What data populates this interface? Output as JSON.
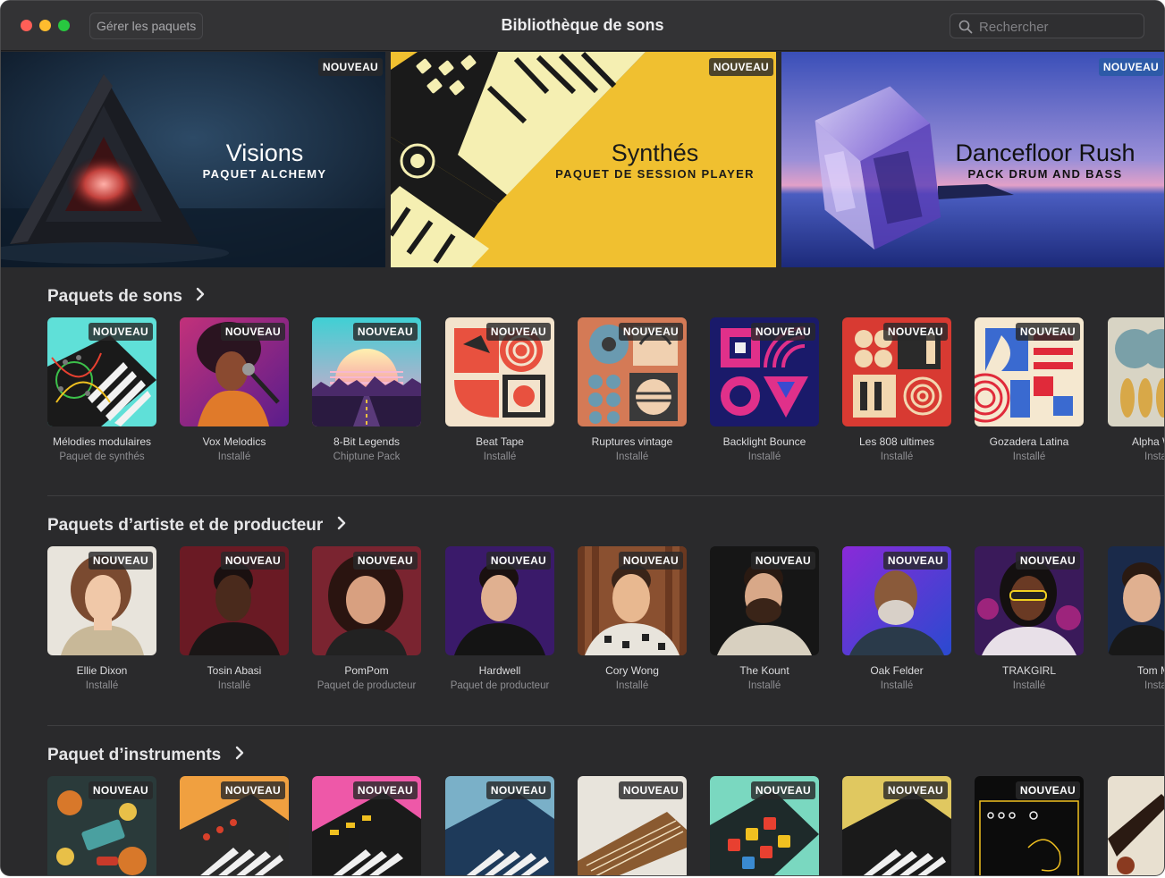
{
  "window": {
    "title": "Bibliothèque de sons",
    "manage_button": "Gérer les paquets",
    "search_placeholder": "Rechercher"
  },
  "badge_label": "NOUVEAU",
  "featured": [
    {
      "title": "Visions",
      "subtitle": "PAQUET ALCHEMY",
      "badge": "NOUVEAU"
    },
    {
      "title": "Synthés",
      "subtitle": "PAQUET DE SESSION PLAYER",
      "badge": "NOUVEAU"
    },
    {
      "title": "Dancefloor Rush",
      "subtitle": "PACK DRUM AND BASS",
      "badge": "NOUVEAU"
    }
  ],
  "sections": [
    {
      "title": "Paquets de sons",
      "items": [
        {
          "name": "Mélodies modulaires",
          "status": "Paquet de synthés",
          "badge": "NOUVEAU"
        },
        {
          "name": "Vox Melodics",
          "status": "Installé",
          "badge": "NOUVEAU"
        },
        {
          "name": "8-Bit Legends",
          "status": "Chiptune Pack",
          "badge": "NOUVEAU"
        },
        {
          "name": "Beat Tape",
          "status": "Installé",
          "badge": "NOUVEAU"
        },
        {
          "name": "Ruptures vintage",
          "status": "Installé",
          "badge": "NOUVEAU"
        },
        {
          "name": "Backlight Bounce",
          "status": "Installé",
          "badge": "NOUVEAU"
        },
        {
          "name": "Les 808 ultimes",
          "status": "Installé",
          "badge": "NOUVEAU"
        },
        {
          "name": "Gozadera Latina",
          "status": "Installé",
          "badge": "NOUVEAU"
        },
        {
          "name": "Alpha W",
          "status": "Insta",
          "badge": ""
        }
      ]
    },
    {
      "title": "Paquets d’artiste et de producteur",
      "items": [
        {
          "name": "Ellie Dixon",
          "status": "Installé",
          "badge": "NOUVEAU"
        },
        {
          "name": "Tosin Abasi",
          "status": "Installé",
          "badge": "NOUVEAU"
        },
        {
          "name": "PomPom",
          "status": "Paquet de producteur",
          "badge": "NOUVEAU"
        },
        {
          "name": "Hardwell",
          "status": "Paquet de producteur",
          "badge": "NOUVEAU"
        },
        {
          "name": "Cory Wong",
          "status": "Installé",
          "badge": "NOUVEAU"
        },
        {
          "name": "The Kount",
          "status": "Installé",
          "badge": "NOUVEAU"
        },
        {
          "name": "Oak Felder",
          "status": "Installé",
          "badge": "NOUVEAU"
        },
        {
          "name": "TRAKGIRL",
          "status": "Installé",
          "badge": "NOUVEAU"
        },
        {
          "name": "Tom M",
          "status": "Insta",
          "badge": ""
        }
      ]
    },
    {
      "title": "Paquet d’instruments",
      "items": [
        {
          "badge": "NOUVEAU"
        },
        {
          "badge": "NOUVEAU"
        },
        {
          "badge": "NOUVEAU"
        },
        {
          "badge": "NOUVEAU"
        },
        {
          "badge": "NOUVEAU"
        },
        {
          "badge": "NOUVEAU"
        },
        {
          "badge": "NOUVEAU"
        },
        {
          "badge": "NOUVEAU"
        },
        {
          "badge": ""
        }
      ]
    }
  ]
}
